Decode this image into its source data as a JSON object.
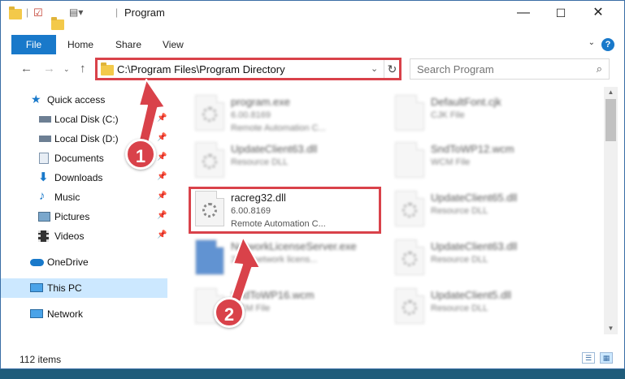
{
  "window": {
    "title": "Program",
    "controls": {
      "minimize": "—",
      "maximize": "☐",
      "close": "✕"
    }
  },
  "ribbon": {
    "tabs": [
      {
        "label": "File"
      },
      {
        "label": "Home"
      },
      {
        "label": "Share"
      },
      {
        "label": "View"
      }
    ],
    "help": "?"
  },
  "address": {
    "path": "C:\\Program Files\\Program Directory",
    "refresh": "↻",
    "dropdown": "⌄"
  },
  "search": {
    "placeholder": "Search Program"
  },
  "sidebar": {
    "items": [
      {
        "label": "Quick access",
        "icon": "star-icon"
      },
      {
        "label": "Local Disk (C:)",
        "icon": "drive-icon",
        "pinned": true
      },
      {
        "label": "Local Disk (D:)",
        "icon": "drive-icon",
        "pinned": true
      },
      {
        "label": "Documents",
        "icon": "documents-icon",
        "pinned": true
      },
      {
        "label": "Downloads",
        "icon": "downloads-icon",
        "pinned": true
      },
      {
        "label": "Music",
        "icon": "music-icon",
        "pinned": true
      },
      {
        "label": "Pictures",
        "icon": "pictures-icon",
        "pinned": true
      },
      {
        "label": "Videos",
        "icon": "videos-icon",
        "pinned": true
      },
      {
        "label": "OneDrive",
        "icon": "cloud-icon"
      },
      {
        "label": "This PC",
        "icon": "computer-icon",
        "selected": true
      },
      {
        "label": "Network",
        "icon": "network-icon"
      }
    ]
  },
  "files": [
    {
      "name": "program.exe",
      "version": "6.00.8169",
      "desc": "Remote Automation C...",
      "blurred": true
    },
    {
      "name": "DefaultFont.cjk",
      "version": "CJK File",
      "desc": "",
      "blurred": true
    },
    {
      "name": "UpdateClient63.dll",
      "version": "Resource DLL",
      "desc": "",
      "blurred": true
    },
    {
      "name": "SndToWP12.wcm",
      "version": "WCM File",
      "desc": "",
      "blurred": true
    },
    {
      "name": "racreg32.dll",
      "version": "6.00.8169",
      "desc": "Remote Automation C...",
      "blurred": false
    },
    {
      "name": "UpdateClient65.dll",
      "version": "Resource DLL",
      "desc": "",
      "blurred": true
    },
    {
      "name": "NetworkLicenseServer.exe",
      "version": "2007 network licens...",
      "desc": "",
      "blurred": true
    },
    {
      "name": "UpdateClient63.dll",
      "version": "Resource DLL",
      "desc": "",
      "blurred": true
    },
    {
      "name": "SndToWP16.wcm",
      "version": "WCM File",
      "desc": "",
      "blurred": true
    },
    {
      "name": "UpdateClient5.dll",
      "version": "Resource DLL",
      "desc": "",
      "blurred": true
    }
  ],
  "status": {
    "count": "112 items"
  },
  "annotations": {
    "step1": "1",
    "step2": "2",
    "highlight_color": "#d9424a"
  }
}
